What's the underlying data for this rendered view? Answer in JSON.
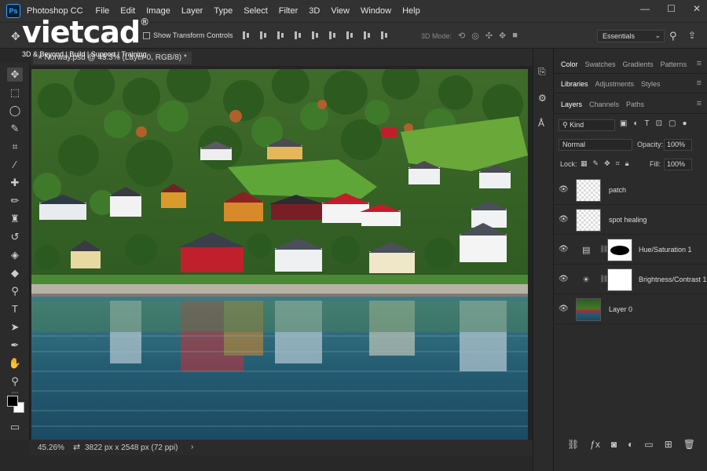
{
  "app": {
    "logo_text": "Ps",
    "name": "Photoshop CC"
  },
  "menu": [
    "File",
    "Edit",
    "Image",
    "Layer",
    "Type",
    "Select",
    "Filter",
    "3D",
    "View",
    "Window",
    "Help"
  ],
  "window_controls": {
    "minimize": "—",
    "maximize": "☐",
    "close": "✕"
  },
  "watermark": {
    "logo": "vietcad",
    "reg": "®",
    "tagline": "3D & Beyond | Build | Support | Training"
  },
  "options": {
    "group_label": "Gr",
    "show_transform_label": "Show Transform Controls",
    "mode_3d_label": "3D Mode:",
    "workspace": "Essentials"
  },
  "document": {
    "tab_label": "× Norway.psd @ 45.3% (Layer 0, RGB/8) *",
    "zoom": "45.26%",
    "size": "3822 px x 2548 px (72 ppi)"
  },
  "panels": {
    "row1": [
      "Color",
      "Swatches",
      "Gradients",
      "Patterns"
    ],
    "row2": [
      "Libraries",
      "Adjustments",
      "Styles"
    ],
    "row3": [
      "Layers",
      "Channels",
      "Paths"
    ]
  },
  "layers_panel": {
    "kind_label": "Kind",
    "blend_mode": "Normal",
    "opacity_label": "Opacity:",
    "opacity": "100%",
    "lock_label": "Lock:",
    "fill_label": "Fill:",
    "fill": "100%"
  },
  "layers": [
    {
      "name": "patch",
      "type": "pixel"
    },
    {
      "name": "spot healing",
      "type": "pixel"
    },
    {
      "name": "Hue/Saturation 1",
      "type": "adjustment"
    },
    {
      "name": "Brightness/Contrast 1",
      "type": "adjustment"
    },
    {
      "name": "Layer 0",
      "type": "image"
    }
  ],
  "colors": {
    "accent": "#31a8ff",
    "panel_bg": "#2b2b2b",
    "bar_bg": "#323232"
  }
}
